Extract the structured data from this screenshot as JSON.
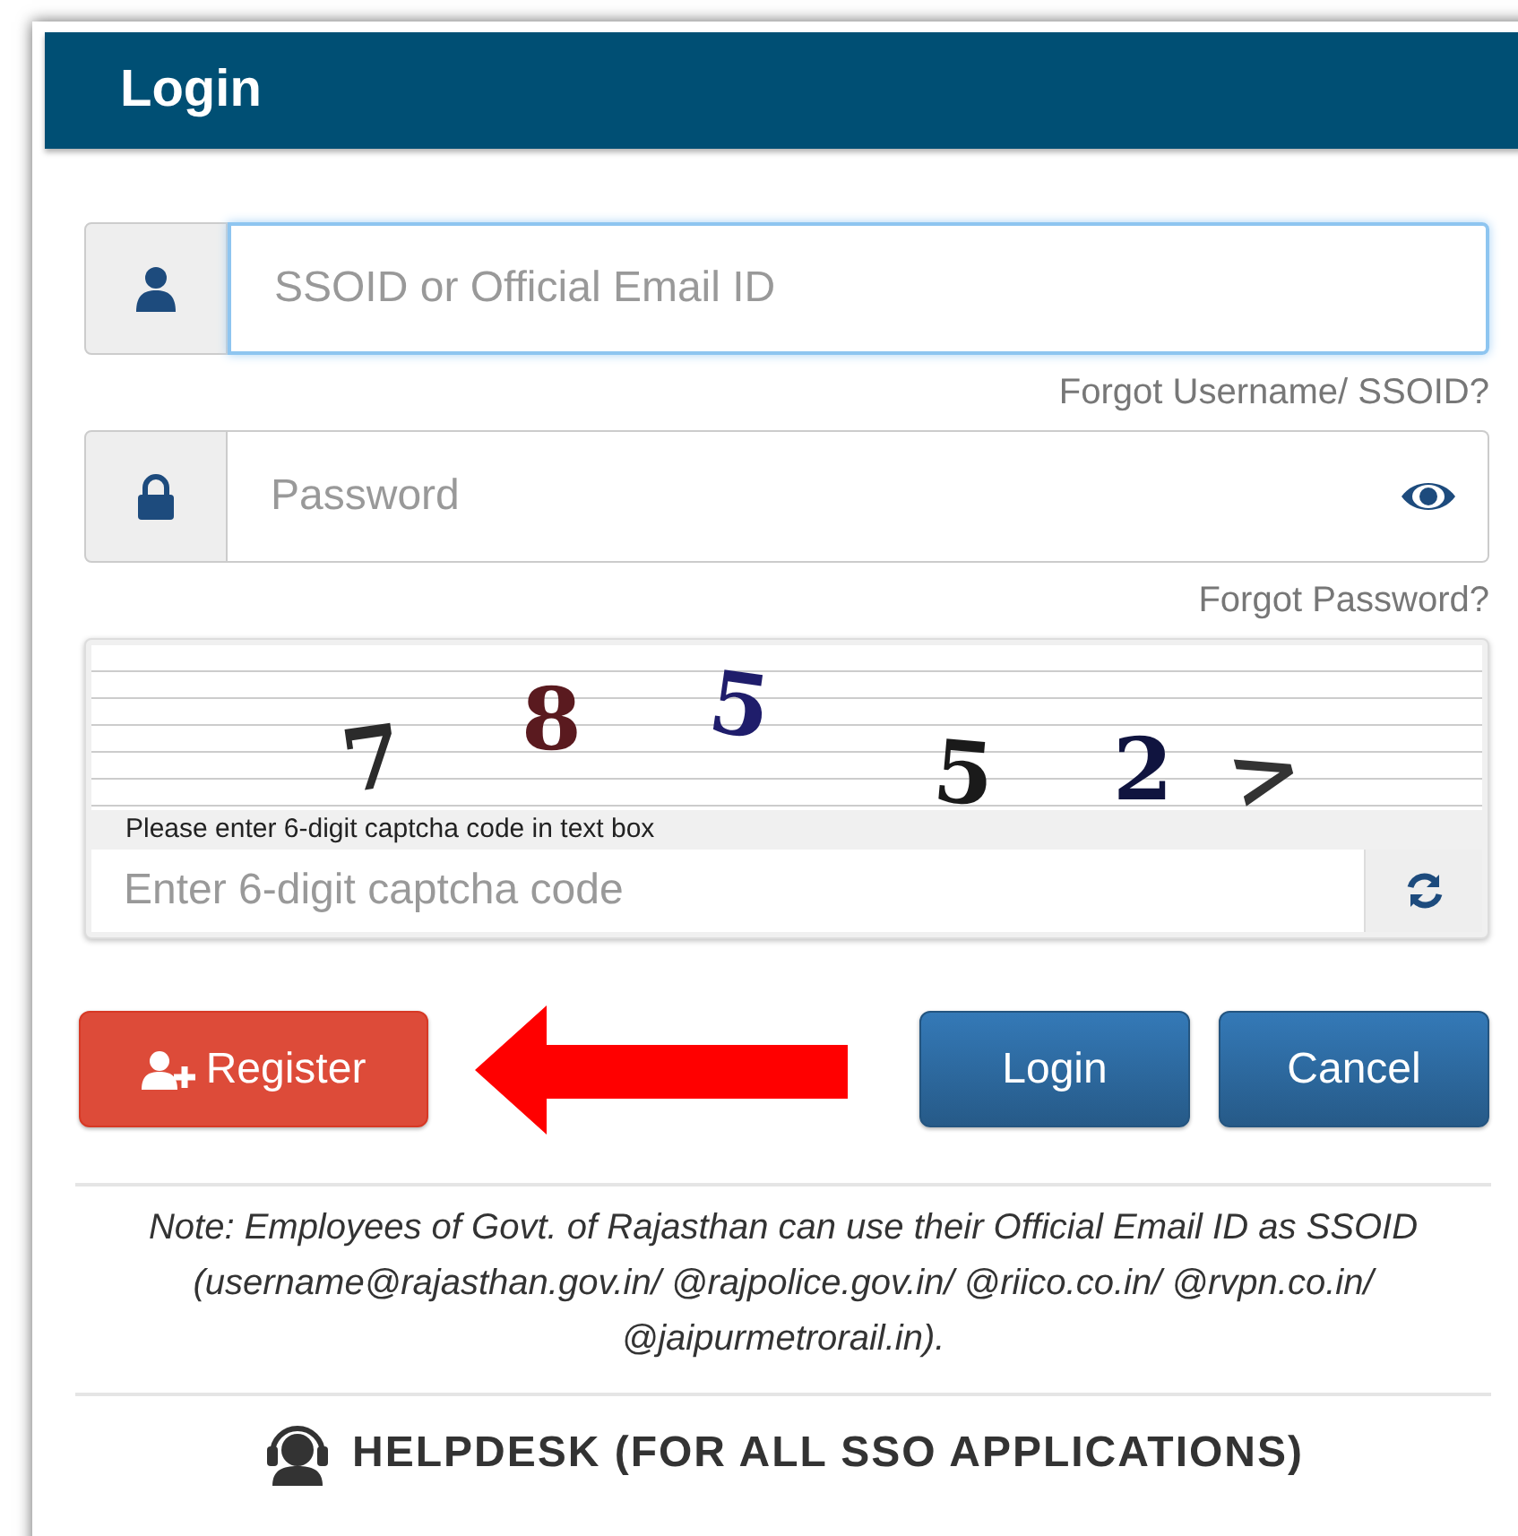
{
  "header": {
    "title": "Login"
  },
  "username": {
    "placeholder": "SSOID or Official Email ID",
    "focused": true,
    "forgot_link": "Forgot Username/ SSOID?"
  },
  "password": {
    "placeholder": "Password",
    "forgot_link": "Forgot Password?"
  },
  "captcha": {
    "characters": [
      {
        "char": "7",
        "color": "#2b2b2b"
      },
      {
        "char": "8",
        "color": "#5a1a1f"
      },
      {
        "char": "5",
        "color": "#1f1d6b"
      },
      {
        "char": "5",
        "color": "#1a1a1a"
      },
      {
        "char": "2",
        "color": "#10143f"
      },
      {
        "char": ">",
        "color": "#333333"
      }
    ],
    "hint": "Please enter 6-digit captcha code in text box",
    "placeholder": "Enter 6-digit captcha code"
  },
  "buttons": [
    {
      "kind": "register",
      "label": "Register"
    },
    {
      "kind": "arrow"
    },
    {
      "kind": "primary",
      "label": "Login"
    },
    {
      "kind": "primary",
      "label": "Cancel"
    }
  ],
  "note": "Note: Employees of Govt. of Rajasthan can use their Official Email ID as SSOID (username@rajasthan.gov.in/ @rajpolice.gov.in/ @riico.co.in/ @rvpn.co.in/ @jaipurmetrorail.in).",
  "helpdesk": "HELPDESK (FOR ALL SSO APPLICATIONS)"
}
